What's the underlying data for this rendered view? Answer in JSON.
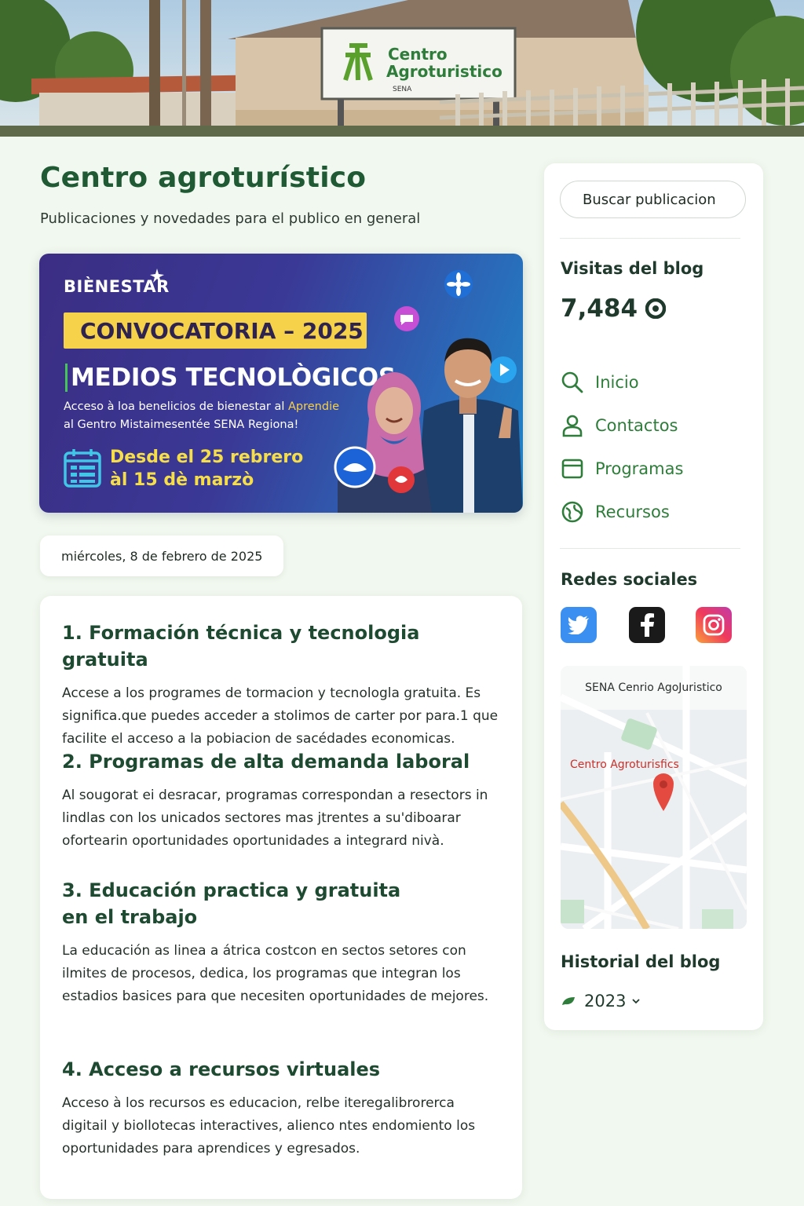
{
  "hero": {
    "sign_line1": "Centro",
    "sign_line2": "Agroturistico",
    "sign_small": "SENA"
  },
  "header": {
    "title": "Centro agroturístico",
    "subtitle": "Publicaciones y novedades para el publico en general"
  },
  "banner": {
    "brand": "BIÈNESTAR",
    "ribbon": "CONVOCATORIA – 2025",
    "headline": "MEDIOS TECNOLÒGICOS",
    "desc_line1": "Acceso à loa benelicios de bienestar al ",
    "desc_highlight": "Aprendie",
    "desc_line2": "al Gentro Mistaimesentée SENA Regiona!",
    "dates_line1": "Desde el 25 rebrero",
    "dates_line2": "àl 15 dè marzò"
  },
  "post": {
    "date": "miércoles, 8 de febrero de 2025",
    "sections": [
      {
        "title": "1. Formación técnica y tecnologia gratuita",
        "body": "Accese a los programes de tormacion y tecnologla gratuita. Es significa.que puedes acceder a stolimos de carter por para.1 que facilite el acceso a la pobiacion de sacédades economicas."
      },
      {
        "title": "2. Programas de alta demanda laboral",
        "body": "Al sougorat ei desracar, programas correspondan a resectors in lindlas con los unicados sectores mas jtrentes a su'diboarar ofortearin oportunidades oportunidades a integrard nivà."
      },
      {
        "title": "3. Educación practica y gratuita en el trabajo",
        "body": "La educación as linea a átrica costcon en sectos setores con ilmites de procesos, dedica, los programas que integran los estadios basices para que necesiten oportunidades de mejores."
      },
      {
        "title": "4. Acceso a recursos virtuales",
        "body": "Acceso à los recursos es educacion, relbe iteregalibrorerca digitail y biollotecas interactives, alienco ntes endomiento los oportunidades para aprendices y egresados."
      }
    ]
  },
  "sidebar": {
    "search_placeholder": "Buscar publicacion",
    "visits_heading": "Visitas del blog",
    "visits_count": "7,484",
    "nav": [
      {
        "label": "Inicio",
        "icon": "search-icon"
      },
      {
        "label": "Contactos",
        "icon": "user-icon"
      },
      {
        "label": "Programas",
        "icon": "window-icon"
      },
      {
        "label": "Recursos",
        "icon": "globe-icon"
      }
    ],
    "social_heading": "Redes sociales",
    "social": [
      {
        "name": "twitter",
        "color": "#3b8ff0"
      },
      {
        "name": "facebook",
        "color": "#1a1a1a"
      },
      {
        "name": "instagram",
        "color": "#f0446a"
      }
    ],
    "map_title": "SENA Cenrio AgoJuristico",
    "map_label": "Centro Agroturisfics",
    "history_heading": "Historial del blog",
    "history_year": "2023"
  },
  "colors": {
    "accent": "#2e7d3a",
    "title": "#1f5a34",
    "background": "#f1f8ef"
  }
}
